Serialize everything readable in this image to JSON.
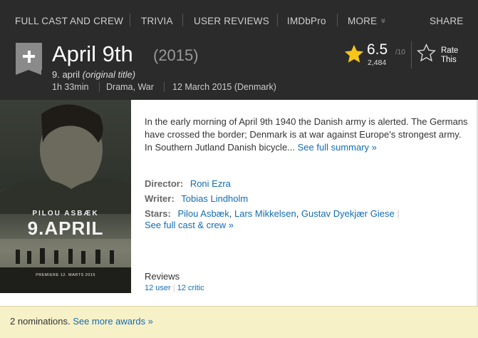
{
  "nav": {
    "full_cast": "FULL CAST AND CREW",
    "trivia": "TRIVIA",
    "user_reviews": "USER REVIEWS",
    "imdbpro": "IMDbPro",
    "more": "MORE",
    "more_icon": "»",
    "share": "SHARE"
  },
  "title": {
    "name": "April 9th",
    "year": "(2015)",
    "original_name": "9. april",
    "original_note": "(original title)",
    "runtime": "1h 33min",
    "genres": "Drama, War",
    "release": "12 March 2015 (Denmark)"
  },
  "rating": {
    "value": "6.5",
    "max": "/10",
    "votes": "2,484",
    "rate_line1": "Rate",
    "rate_line2": "This"
  },
  "poster": {
    "actor": "PILOU ASBÆK",
    "title": "9.APRIL",
    "premiere": "PREMIERE 12. MARTS 2015"
  },
  "summary": {
    "text": "In the early morning of April 9th 1940 the Danish army is alerted. The Germans have crossed the border; Denmark is at war against Europe's strongest army. In Southern Jutland Danish bicycle...",
    "link": "See full summary »"
  },
  "credits": {
    "director_label": "Director:",
    "director": "Roni Ezra",
    "writer_label": "Writer:",
    "writer": "Tobias Lindholm",
    "stars_label": "Stars:",
    "stars": [
      "Pilou Asbæk",
      "Lars Mikkelsen",
      "Gustav Dyekjær Giese"
    ],
    "full_cast_link": "See full cast & crew »"
  },
  "reviews": {
    "label": "Reviews",
    "user": "12 user",
    "critic": "12 critic"
  },
  "awards": {
    "text": "2 nominations.",
    "link": "See more awards »"
  },
  "colors": {
    "header_bg": "#2b2b2b",
    "link": "#136cb2",
    "star": "#f5c518",
    "awards_bg": "#f7f1c8"
  }
}
